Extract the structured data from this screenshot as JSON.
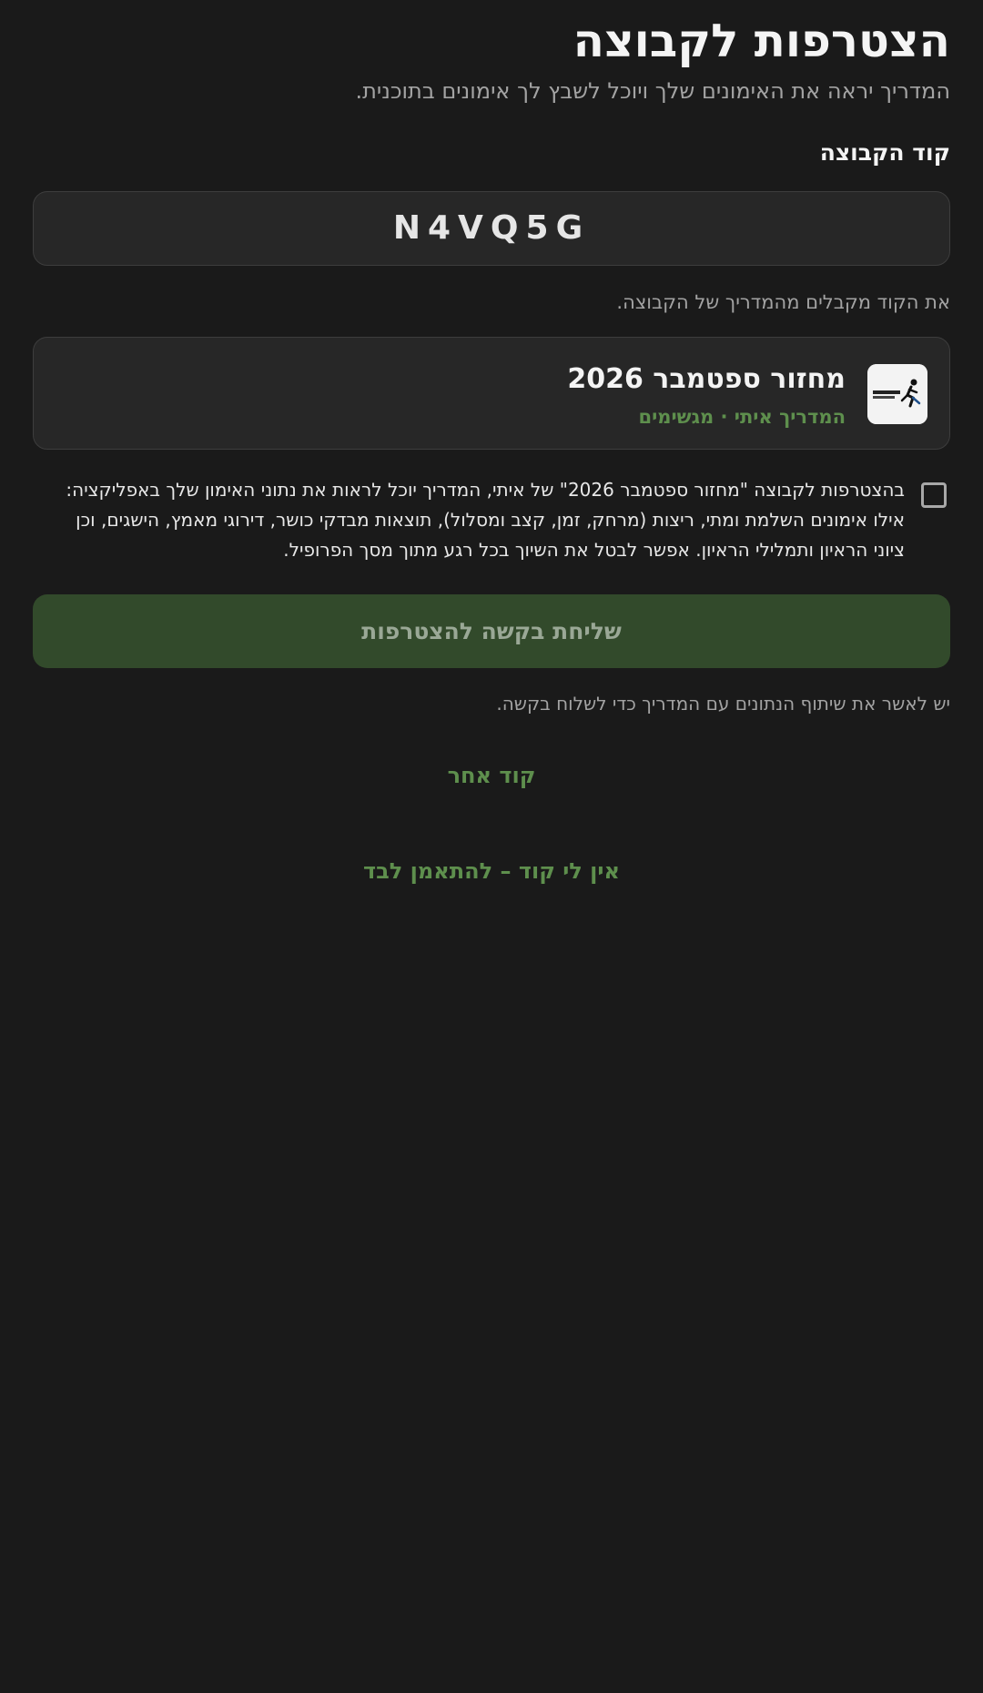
{
  "header": {
    "title": "הצטרפות לקבוצה",
    "subtitle": "המדריך יראה את האימונים שלך ויוכל לשבץ לך אימונים בתוכנית."
  },
  "code": {
    "label": "קוד הקבוצה",
    "value": "N4VQ5G",
    "hint": "את הקוד מקבלים מהמדריך של הקבוצה."
  },
  "group": {
    "name": "מחזור ספטמבר 2026",
    "coach_line": "המדריך איתי · מגשימים",
    "logo_text": "מגשימים",
    "logo_icon": "runner-icon"
  },
  "consent": {
    "checked": false,
    "text": "בהצטרפות לקבוצה \"מחזור ספטמבר 2026\" של איתי, המדריך יוכל לראות את נתוני האימון שלך באפליקציה: אילו אימונים השלמת ומתי, ריצות (מרחק, זמן, קצב ומסלול), תוצאות מבדקי כושר, דירוגי מאמץ, הישגים, וכן ציוני הראיון ותמלילי הראיון. אפשר לבטל את השיוך בכל רגע מתוך מסך הפרופיל."
  },
  "actions": {
    "submit_label": "שליחת בקשה להצטרפות",
    "submit_hint": "יש לאשר את שיתוף הנתונים עם המדריך כדי לשלוח בקשה.",
    "other_code_label": "קוד אחר",
    "no_code_label": "אין לי קוד – להתאמן לבד"
  },
  "colors": {
    "background": "#1a1a1a",
    "card": "#272727",
    "accent": "#5e8f4d",
    "button_disabled": "#324a2b"
  }
}
